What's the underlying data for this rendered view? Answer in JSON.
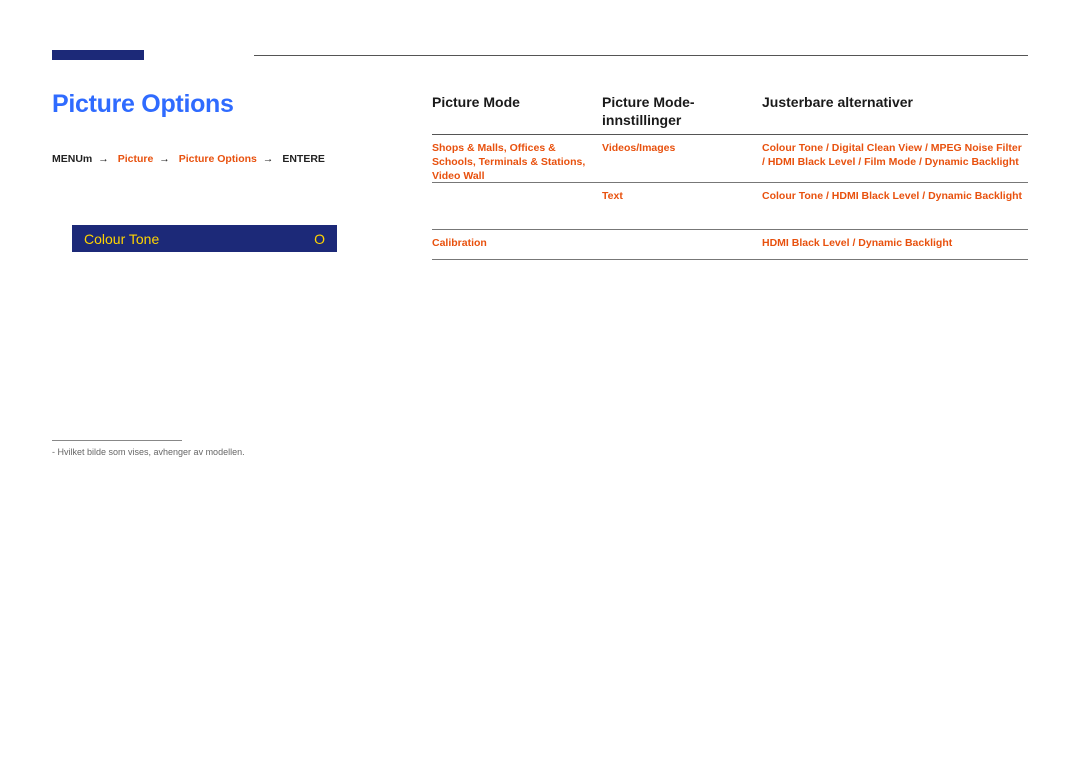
{
  "title": "Picture Options",
  "breadcrumb": {
    "pre": "MENU",
    "item1": "Picture",
    "item2": "Picture Options",
    "post": "ENTER"
  },
  "menu_item": {
    "label": "Colour Tone",
    "value": "O"
  },
  "footnote": "Hvilket bilde som vises, avhenger av modellen.",
  "table": {
    "head": {
      "c1": "Picture Mode",
      "c2": "Picture Mode-innstillinger",
      "c3": "Justerbare alternativer"
    },
    "rows": [
      {
        "c1": "Shops & Malls, Offices & Schools, Terminals & Stations, Video Wall",
        "c2": "Videos/Images",
        "c3": "Colour Tone / Digital Clean View / MPEG Noise Filter / HDMI Black Level / Film Mode / Dynamic Backlight"
      },
      {
        "c1": "",
        "c2": "Text",
        "c3": "Colour Tone / HDMI Black Level / Dynamic Backlight"
      },
      {
        "c1": "Calibration",
        "c2": "",
        "c3": "HDMI Black Level / Dynamic Backlight"
      }
    ]
  }
}
